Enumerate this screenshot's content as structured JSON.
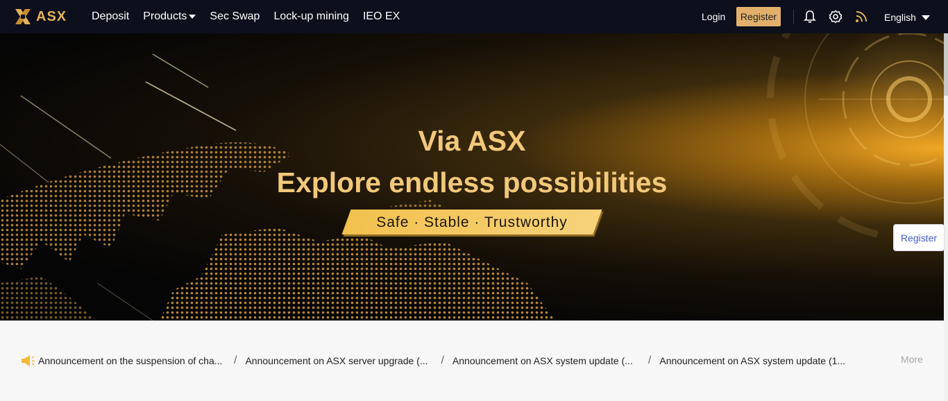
{
  "brand": {
    "name": "ASX",
    "accent": "#e5b25b"
  },
  "nav": {
    "items": [
      {
        "label": "Deposit"
      },
      {
        "label": "Products",
        "dropdown": true
      },
      {
        "label": "Sec Swap"
      },
      {
        "label": "Lock-up mining"
      },
      {
        "label": "IEO EX"
      }
    ],
    "login": "Login",
    "register": "Register",
    "language": "English",
    "icons": [
      "bell-icon",
      "settings-icon",
      "rss-icon"
    ]
  },
  "hero": {
    "title": "Via ASX",
    "subtitle": "Explore endless possibilities",
    "tagline": "Safe · Stable · Trustworthy"
  },
  "side_register": "Register",
  "announcements": {
    "items": [
      "Announcement on the suspension of cha...",
      "Announcement on ASX server upgrade (...",
      "Announcement on ASX system update (...",
      "Announcement on ASX system update (1..."
    ],
    "separator": "/",
    "more": "More"
  }
}
